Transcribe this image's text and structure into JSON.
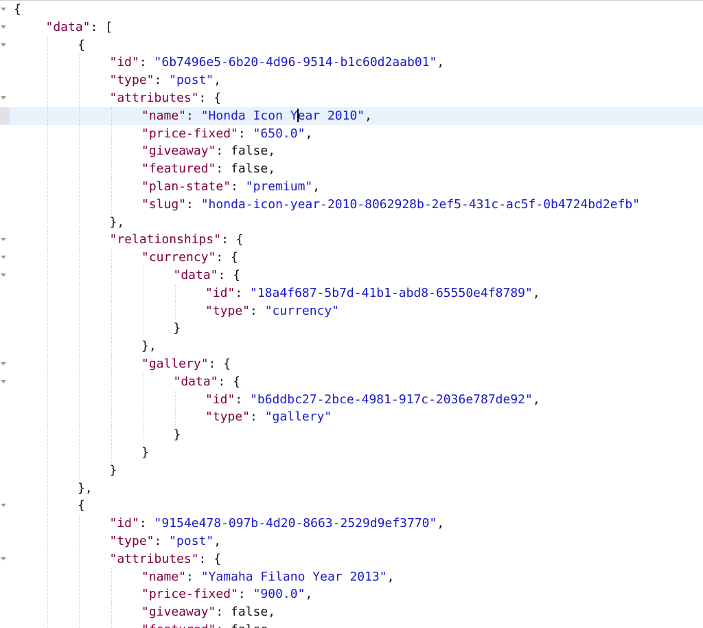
{
  "editor": {
    "colors": {
      "key": "#800040",
      "string": "#1a1acc",
      "punct": "#111111",
      "active_line": "#e8f2fc"
    },
    "fold_icon": "chevron-down-icon",
    "lines": [
      {
        "indent": 0,
        "fold": true,
        "tokens": [
          {
            "t": "p",
            "v": "{"
          }
        ]
      },
      {
        "indent": 1,
        "fold": true,
        "tokens": [
          {
            "t": "k",
            "v": "\"data\""
          },
          {
            "t": "p",
            "v": ": ["
          }
        ]
      },
      {
        "indent": 2,
        "fold": true,
        "tokens": [
          {
            "t": "p",
            "v": "{"
          }
        ]
      },
      {
        "indent": 3,
        "fold": false,
        "tokens": [
          {
            "t": "k",
            "v": "\"id\""
          },
          {
            "t": "p",
            "v": ": "
          },
          {
            "t": "s",
            "v": "\"6b7496e5-6b20-4d96-9514-b1c60d2aab01\""
          },
          {
            "t": "p",
            "v": ","
          }
        ]
      },
      {
        "indent": 3,
        "fold": false,
        "tokens": [
          {
            "t": "k",
            "v": "\"type\""
          },
          {
            "t": "p",
            "v": ": "
          },
          {
            "t": "s",
            "v": "\"post\""
          },
          {
            "t": "p",
            "v": ","
          }
        ]
      },
      {
        "indent": 3,
        "fold": true,
        "tokens": [
          {
            "t": "k",
            "v": "\"attributes\""
          },
          {
            "t": "p",
            "v": ": {"
          }
        ]
      },
      {
        "indent": 4,
        "fold": false,
        "active": true,
        "tokens": [
          {
            "t": "k",
            "v": "\"name\""
          },
          {
            "t": "p",
            "v": ": "
          },
          {
            "t": "s",
            "v": "\"Honda Icon Y"
          },
          {
            "t": "cursor",
            "v": ""
          },
          {
            "t": "s",
            "v": "ear 2010\""
          },
          {
            "t": "p",
            "v": ","
          }
        ]
      },
      {
        "indent": 4,
        "fold": false,
        "tokens": [
          {
            "t": "k",
            "v": "\"price-fixed\""
          },
          {
            "t": "p",
            "v": ": "
          },
          {
            "t": "s",
            "v": "\"650.0\""
          },
          {
            "t": "p",
            "v": ","
          }
        ]
      },
      {
        "indent": 4,
        "fold": false,
        "tokens": [
          {
            "t": "k",
            "v": "\"giveaway\""
          },
          {
            "t": "p",
            "v": ": false,"
          }
        ]
      },
      {
        "indent": 4,
        "fold": false,
        "tokens": [
          {
            "t": "k",
            "v": "\"featured\""
          },
          {
            "t": "p",
            "v": ": false,"
          }
        ]
      },
      {
        "indent": 4,
        "fold": false,
        "tokens": [
          {
            "t": "k",
            "v": "\"plan-state\""
          },
          {
            "t": "p",
            "v": ": "
          },
          {
            "t": "s",
            "v": "\"premium\""
          },
          {
            "t": "p",
            "v": ","
          }
        ]
      },
      {
        "indent": 4,
        "fold": false,
        "tokens": [
          {
            "t": "k",
            "v": "\"slug\""
          },
          {
            "t": "p",
            "v": ": "
          },
          {
            "t": "s",
            "v": "\"honda-icon-year-2010-8062928b-2ef5-431c-ac5f-0b4724bd2efb\""
          }
        ]
      },
      {
        "indent": 3,
        "fold": false,
        "tokens": [
          {
            "t": "p",
            "v": "},"
          }
        ]
      },
      {
        "indent": 3,
        "fold": true,
        "tokens": [
          {
            "t": "k",
            "v": "\"relationships\""
          },
          {
            "t": "p",
            "v": ": {"
          }
        ]
      },
      {
        "indent": 4,
        "fold": true,
        "tokens": [
          {
            "t": "k",
            "v": "\"currency\""
          },
          {
            "t": "p",
            "v": ": {"
          }
        ]
      },
      {
        "indent": 5,
        "fold": true,
        "tokens": [
          {
            "t": "k",
            "v": "\"data\""
          },
          {
            "t": "p",
            "v": ": {"
          }
        ]
      },
      {
        "indent": 6,
        "fold": false,
        "tokens": [
          {
            "t": "k",
            "v": "\"id\""
          },
          {
            "t": "p",
            "v": ": "
          },
          {
            "t": "s",
            "v": "\"18a4f687-5b7d-41b1-abd8-65550e4f8789\""
          },
          {
            "t": "p",
            "v": ","
          }
        ]
      },
      {
        "indent": 6,
        "fold": false,
        "tokens": [
          {
            "t": "k",
            "v": "\"type\""
          },
          {
            "t": "p",
            "v": ": "
          },
          {
            "t": "s",
            "v": "\"currency\""
          }
        ]
      },
      {
        "indent": 5,
        "fold": false,
        "tokens": [
          {
            "t": "p",
            "v": "}"
          }
        ]
      },
      {
        "indent": 4,
        "fold": false,
        "tokens": [
          {
            "t": "p",
            "v": "},"
          }
        ]
      },
      {
        "indent": 4,
        "fold": true,
        "tokens": [
          {
            "t": "k",
            "v": "\"gallery\""
          },
          {
            "t": "p",
            "v": ": {"
          }
        ]
      },
      {
        "indent": 5,
        "fold": true,
        "tokens": [
          {
            "t": "k",
            "v": "\"data\""
          },
          {
            "t": "p",
            "v": ": {"
          }
        ]
      },
      {
        "indent": 6,
        "fold": false,
        "tokens": [
          {
            "t": "k",
            "v": "\"id\""
          },
          {
            "t": "p",
            "v": ": "
          },
          {
            "t": "s",
            "v": "\"b6ddbc27-2bce-4981-917c-2036e787de92\""
          },
          {
            "t": "p",
            "v": ","
          }
        ]
      },
      {
        "indent": 6,
        "fold": false,
        "tokens": [
          {
            "t": "k",
            "v": "\"type\""
          },
          {
            "t": "p",
            "v": ": "
          },
          {
            "t": "s",
            "v": "\"gallery\""
          }
        ]
      },
      {
        "indent": 5,
        "fold": false,
        "tokens": [
          {
            "t": "p",
            "v": "}"
          }
        ]
      },
      {
        "indent": 4,
        "fold": false,
        "tokens": [
          {
            "t": "p",
            "v": "}"
          }
        ]
      },
      {
        "indent": 3,
        "fold": false,
        "tokens": [
          {
            "t": "p",
            "v": "}"
          }
        ]
      },
      {
        "indent": 2,
        "fold": false,
        "tokens": [
          {
            "t": "p",
            "v": "},"
          }
        ]
      },
      {
        "indent": 2,
        "fold": true,
        "tokens": [
          {
            "t": "p",
            "v": "{"
          }
        ]
      },
      {
        "indent": 3,
        "fold": false,
        "tokens": [
          {
            "t": "k",
            "v": "\"id\""
          },
          {
            "t": "p",
            "v": ": "
          },
          {
            "t": "s",
            "v": "\"9154e478-097b-4d20-8663-2529d9ef3770\""
          },
          {
            "t": "p",
            "v": ","
          }
        ]
      },
      {
        "indent": 3,
        "fold": false,
        "tokens": [
          {
            "t": "k",
            "v": "\"type\""
          },
          {
            "t": "p",
            "v": ": "
          },
          {
            "t": "s",
            "v": "\"post\""
          },
          {
            "t": "p",
            "v": ","
          }
        ]
      },
      {
        "indent": 3,
        "fold": true,
        "tokens": [
          {
            "t": "k",
            "v": "\"attributes\""
          },
          {
            "t": "p",
            "v": ": {"
          }
        ]
      },
      {
        "indent": 4,
        "fold": false,
        "tokens": [
          {
            "t": "k",
            "v": "\"name\""
          },
          {
            "t": "p",
            "v": ": "
          },
          {
            "t": "s",
            "v": "\"Yamaha Filano Year 2013\""
          },
          {
            "t": "p",
            "v": ","
          }
        ]
      },
      {
        "indent": 4,
        "fold": false,
        "tokens": [
          {
            "t": "k",
            "v": "\"price-fixed\""
          },
          {
            "t": "p",
            "v": ": "
          },
          {
            "t": "s",
            "v": "\"900.0\""
          },
          {
            "t": "p",
            "v": ","
          }
        ]
      },
      {
        "indent": 4,
        "fold": false,
        "tokens": [
          {
            "t": "k",
            "v": "\"giveaway\""
          },
          {
            "t": "p",
            "v": ": false,"
          }
        ]
      },
      {
        "indent": 4,
        "fold": false,
        "tokens": [
          {
            "t": "k",
            "v": "\"featured\""
          },
          {
            "t": "p",
            "v": ": false"
          }
        ]
      }
    ]
  }
}
